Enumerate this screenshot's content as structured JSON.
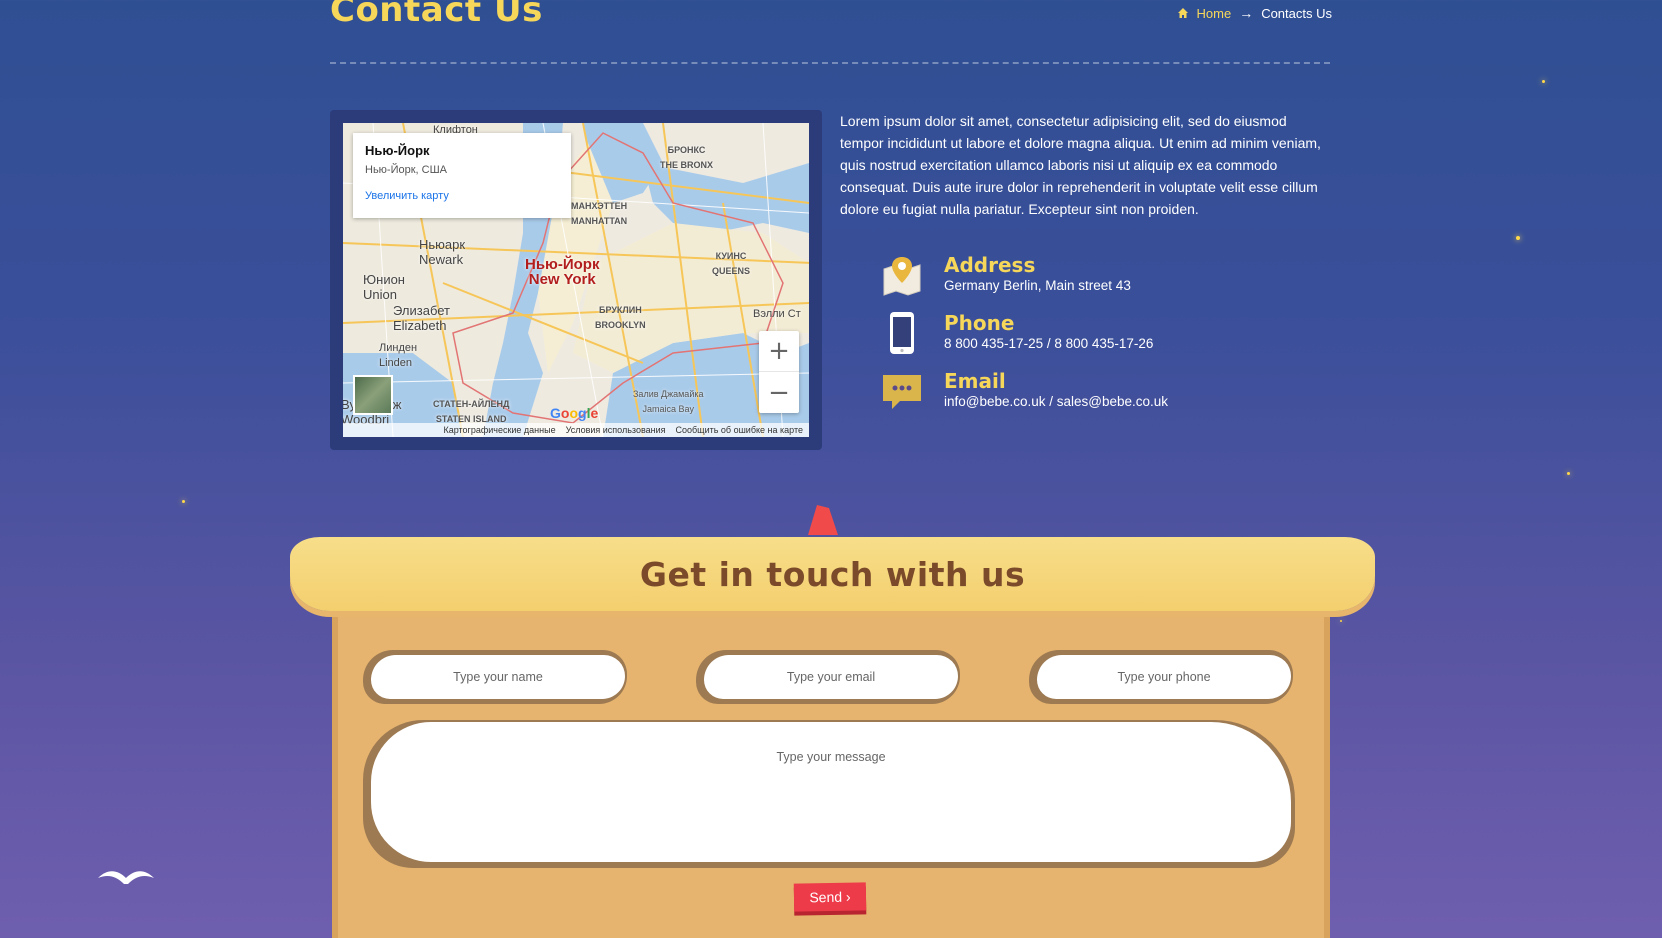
{
  "header": {
    "title": "Contact Us",
    "breadcrumb": {
      "home": "Home",
      "arrow": "→",
      "current": "Contacts Us"
    }
  },
  "map": {
    "popup": {
      "title": "Нью-Йорк",
      "subtitle": "Нью-Йорк, США",
      "link": "Увеличить карту"
    },
    "labels": {
      "city": "Нью-Йорк",
      "city_en": "New York",
      "newark": "Ньюарк",
      "newark_en": "Newark",
      "union": "Юнион",
      "union_en": "Union",
      "elizabeth": "Элизабет",
      "elizabeth_en": "Elizabeth",
      "linden": "Линден",
      "linden_en": "Linden",
      "bronx": "БРОНКС",
      "bronx_en": "THE BRONX",
      "manhattan": "МАНХЭТТЕН",
      "manhattan_en": "MANHATTAN",
      "queens": "КУИНС",
      "queens_en": "QUEENS",
      "brooklyn": "БРУКЛИН",
      "brooklyn_en": "BROOKLYN",
      "staten": "СТАТЕН-АЙЛЕНД",
      "staten_en": "STATEN ISLAND",
      "valley": "Вэлли Ст",
      "woodbridge": "Вудбридж",
      "woodbridge_en": "Woodbri",
      "jamaica": "Залив Джамайка",
      "jamaica_en": "Jamaica Bay",
      "top": "Клифтон"
    },
    "zoom_in": "+",
    "zoom_out": "−",
    "google": "Google",
    "footer": [
      "Картографические данные",
      "Условия использования",
      "Сообщить об ошибке на карте"
    ]
  },
  "intro": "Lorem ipsum dolor sit amet, consectetur adipisicing elit, sed do eiusmod tempor incididunt ut labore et dolore magna aliqua. Ut enim ad minim veniam, quis nostrud exercitation ullamco laboris nisi ut aliquip ex ea commodo consequat. Duis aute irure dolor in reprehenderit in voluptate velit esse cillum dolore eu fugiat nulla pariatur. Excepteur sint non proiden.",
  "contacts": {
    "address": {
      "title": "Address",
      "text": "Germany Berlin, Main street 43",
      "icon": "map-pin-icon"
    },
    "phone": {
      "title": "Phone",
      "text": "8 800 435-17-25 / 8 800 435-17-26",
      "icon": "mobile-phone-icon"
    },
    "email": {
      "title": "Email",
      "text": "info@bebe.co.uk / sales@bebe.co.uk",
      "icon": "chat-bubble-icon"
    }
  },
  "form": {
    "title": "Get in touch with us",
    "name_placeholder": "Type your name",
    "email_placeholder": "Type your email",
    "phone_placeholder": "Type your phone",
    "message_placeholder": "Type your message",
    "send_label": "Send ›"
  },
  "colors": {
    "accent": "#f6d75a",
    "button": "#ee3b4a",
    "board": "#e6b46e"
  }
}
